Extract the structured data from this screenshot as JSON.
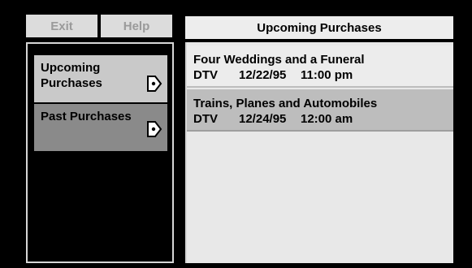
{
  "top_buttons": {
    "exit_label": "Exit",
    "help_label": "Help"
  },
  "sidebar": {
    "items": [
      {
        "label": "Upcoming Purchases",
        "icon": "play-arrow-icon"
      },
      {
        "label": "Past Purchases",
        "icon": "play-arrow-icon"
      }
    ]
  },
  "main": {
    "title": "Upcoming Purchases",
    "purchases": [
      {
        "title": "Four Weddings and a Funeral",
        "channel": "DTV",
        "date": "12/22/95",
        "time": "11:00 pm"
      },
      {
        "title": "Trains, Planes and Automobiles",
        "channel": "DTV",
        "date": "12/24/95",
        "time": "12:00 am"
      }
    ]
  },
  "colors": {
    "background": "#000000",
    "selected_row": "#bdbdbd",
    "panel": "#e8e8e8"
  }
}
